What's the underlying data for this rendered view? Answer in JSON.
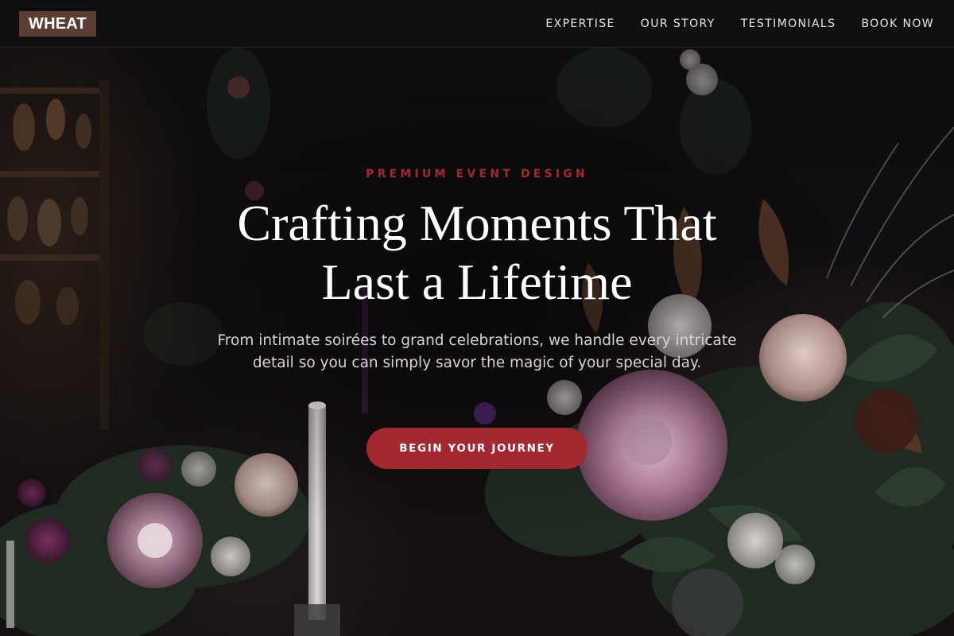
{
  "brand": {
    "logo_text": "WHEAT",
    "logo_bg": "#5c3d33"
  },
  "nav": {
    "items": [
      {
        "label": "EXPERTISE"
      },
      {
        "label": "OUR STORY"
      },
      {
        "label": "TESTIMONIALS"
      },
      {
        "label": "BOOK NOW"
      }
    ]
  },
  "hero": {
    "eyebrow": "PREMIUM EVENT DESIGN",
    "title_line1": "Crafting Moments That",
    "title_line2": "Last a Lifetime",
    "subtitle": "From intimate soirées to grand celebrations, we handle every intricate detail so you can simply savor the magic of your special day.",
    "cta_label": "BEGIN YOUR JOURNEY",
    "background_image": "dark floral arrangement with candles"
  },
  "colors": {
    "accent": "#a3282f",
    "header_bg": "#111011",
    "text_primary": "#ffffff",
    "text_secondary": "#d8d4d5"
  }
}
